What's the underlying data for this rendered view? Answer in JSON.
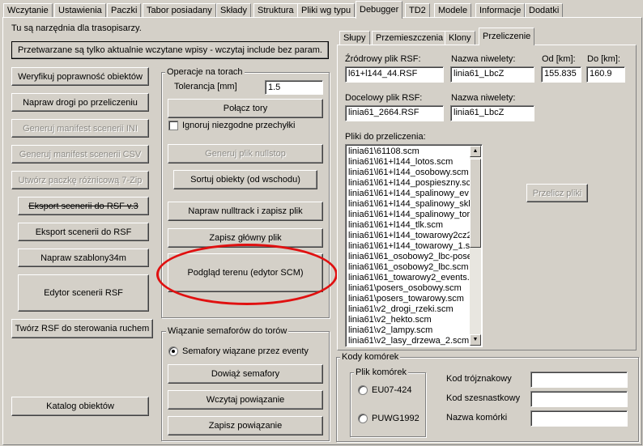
{
  "tabs": [
    "Wczytanie",
    "Ustawienia",
    "Paczki",
    "Tabor posiadany",
    "Składy",
    "Struktura",
    "Pliki wg typu",
    "Debugger",
    "TD2",
    "Modele",
    "Informacje",
    "Dodatki"
  ],
  "active_tab": "Debugger",
  "info_text": "Tu są narzędnia dla trasopisarzy.",
  "current_only_button": "Przetwarzane są tylko aktualnie wczytane wpisy - wczytaj include bez param.",
  "left_buttons": {
    "verify": "Weryfikuj poprawność obiektów",
    "fix_roads": "Napraw drogi po przeliczeniu",
    "manifest_ini": "Generuj manifest scenerii INI",
    "manifest_csv": "Generuj manifest scenerii CSV",
    "diff_package": "Utwórz paczkę różnicową 7-Zip",
    "export_v3": "Eksport scenerii do RSF v.3",
    "export": "Eksport scenerii do RSF",
    "fix_templates": "Napraw szablony34m",
    "editor": "Edytor scenerii RSF",
    "traffic": "Twórz RSF do sterowania ruchem",
    "catalog": "Katalog obiektów"
  },
  "tracks": {
    "legend": "Operacje na torach",
    "tolerance_label": "Tolerancja [mm]",
    "tolerance_value": "1.5",
    "connect": "Połącz tory",
    "ignore_label": "Ignoruj niezgodne przechyłki",
    "nullstop": "Generuj plik nullstop",
    "sort": "Sortuj obiekty (od wschodu)",
    "fix_nulltrack": "Napraw nulltrack i zapisz plik",
    "save_main": "Zapisz główny plik",
    "terrain": "Podgląd terenu (edytor SCM)"
  },
  "signals": {
    "legend": "Wiązanie semaforów do torów",
    "radio_label": "Semafory wiązane przez eventy",
    "bind": "Dowiąż semafory",
    "load": "Wczytaj powiązanie",
    "save": "Zapisz powiązanie"
  },
  "sub_tabs": [
    "Słupy",
    "Przemieszczenia",
    "Klony",
    "Przeliczenie"
  ],
  "active_sub_tab": "Przeliczenie",
  "recalc": {
    "src_label": "Źródrowy plik RSF:",
    "src_value": "l61+l144_44.RSF",
    "level_label": "Nazwa niwelety:",
    "level_value": "linia61_LbcZ",
    "from_label": "Od [km]:",
    "from_value": "155.835",
    "to_label": "Do [km]:",
    "to_value": "160.9",
    "dst_label": "Docelowy plik RSF:",
    "dst_value": "linia61_2664.RSF",
    "level2_label": "Nazwa niwelety:",
    "level2_value": "linia61_LbcZ",
    "files_label": "Pliki do przeliczenia:",
    "files": [
      "linia61\\61108.scm",
      "linia61\\l61+l144_lotos.scm",
      "linia61\\l61+l144_osobowy.scm",
      "linia61\\l61+l144_pospieszny.sc",
      "linia61\\l61+l144_spalinowy_ev",
      "linia61\\l61+l144_spalinowy_skl",
      "linia61\\l61+l144_spalinowy_tor",
      "linia61\\l61+l144_tlk.scm",
      "linia61\\l61+l144_towarowy2cz2",
      "linia61\\l61+l144_towarowy_1.s",
      "linia61\\l61_osobowy2_lbc-pose",
      "linia61\\l61_osobowy2_lbc.scm",
      "linia61\\l61_towarowy2_events.",
      "linia61\\posers_osobowy.scm",
      "linia61\\posers_towarowy.scm",
      "linia61\\v2_drogi_rzeki.scm",
      "linia61\\v2_hekto.scm",
      "linia61\\v2_lampy.scm",
      "linia61\\v2_lasy_drzewa_2.scm"
    ],
    "recalc_button": "Przelicz pliki"
  },
  "cells": {
    "legend": "Kody komórek",
    "file_legend": "Plik komórek",
    "opt1": "EU07-424",
    "opt2": "PUWG1992",
    "trinary_label": "Kod trójznakowy",
    "hex_label": "Kod szesnastkowy",
    "name_label": "Nazwa komórki"
  },
  "highlight_color": "#e01010"
}
